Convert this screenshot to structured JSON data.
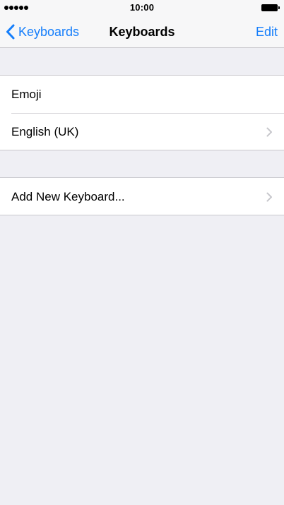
{
  "status_bar": {
    "time": "10:00",
    "signal_icon": "signal-dots-icon",
    "battery_icon": "battery-icon"
  },
  "nav": {
    "back_label": "Keyboards",
    "back_icon": "chevron-left-icon",
    "title": "Keyboards",
    "edit_label": "Edit"
  },
  "keyboards": [
    {
      "label": "Emoji",
      "has_chevron": false
    },
    {
      "label": "English (UK)",
      "has_chevron": true
    }
  ],
  "add_keyboard": {
    "label": "Add New Keyboard...",
    "has_chevron": true
  },
  "colors": {
    "accent": "#157efb",
    "background": "#efeff4",
    "separator": "#c8c7cc",
    "chevron": "#c7c7cc"
  }
}
